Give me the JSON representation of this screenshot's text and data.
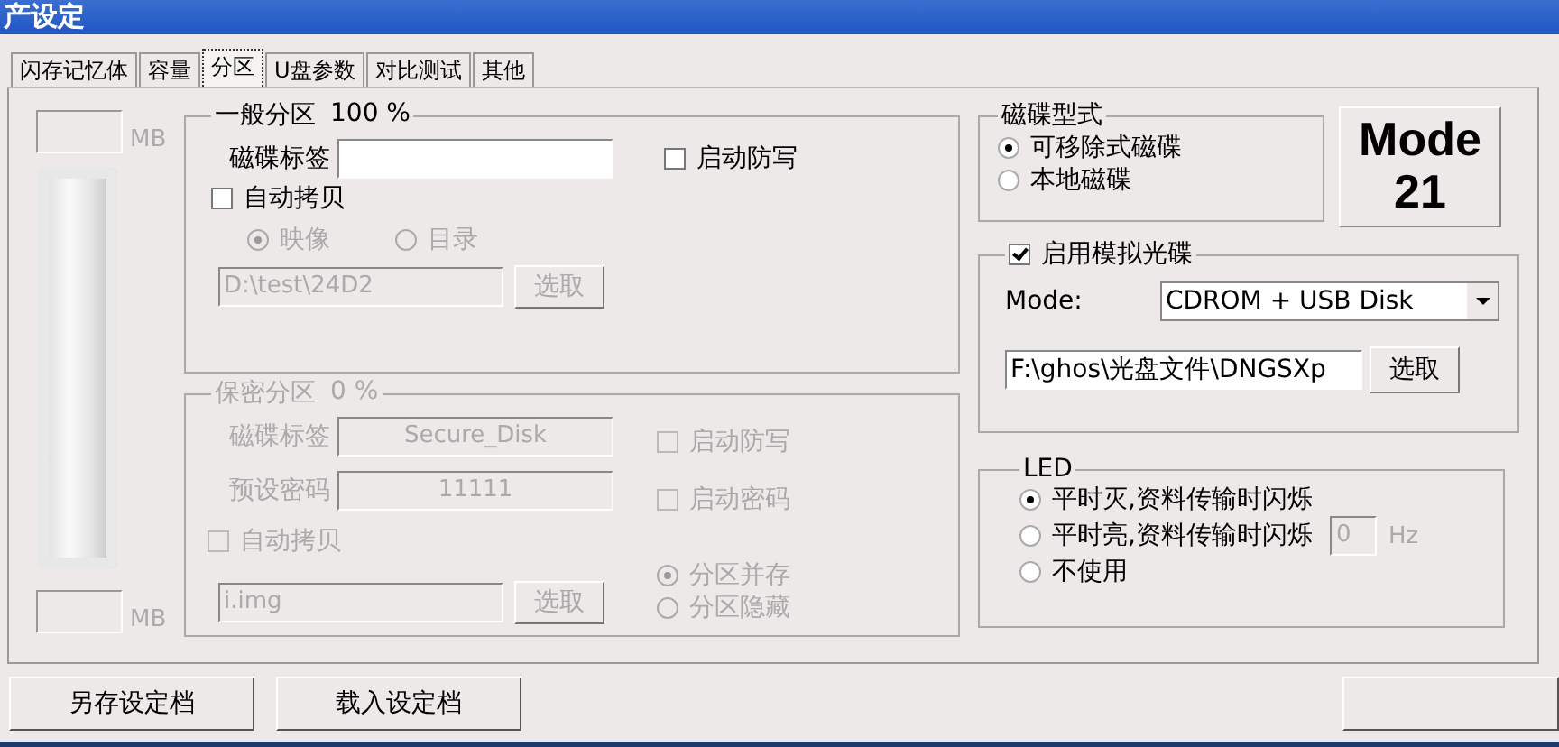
{
  "window": {
    "title": "产设定"
  },
  "tabs": [
    {
      "label": "闪存记忆体",
      "selected": false
    },
    {
      "label": "容量",
      "selected": false
    },
    {
      "label": "分区",
      "selected": true
    },
    {
      "label": "U盘参数",
      "selected": false
    },
    {
      "label": "对比测试",
      "selected": false
    },
    {
      "label": "其他",
      "selected": false
    }
  ],
  "capacity": {
    "top_unit": "MB",
    "bottom_unit": "MB"
  },
  "general_partition": {
    "title": "一般分区",
    "percent": "100 %",
    "disk_label": {
      "label": "磁碟标签"
    },
    "write_protect": {
      "label": "启动防写",
      "checked": false,
      "disabled": false
    },
    "auto_copy": {
      "label": "自动拷贝",
      "checked": false,
      "disabled": false
    },
    "copy_modes": [
      {
        "label": "映像",
        "selected": true,
        "disabled": true
      },
      {
        "label": "目录",
        "selected": false,
        "disabled": true
      }
    ],
    "path": {
      "value": "D:\\test\\24D2",
      "disabled": true
    },
    "select_button": {
      "label": "选取",
      "disabled": true
    }
  },
  "secure_partition": {
    "title": "保密分区",
    "percent": "0 %",
    "disabled": true,
    "disk_label": {
      "label": "磁碟标签",
      "value": "Secure_Disk"
    },
    "password": {
      "label": "预设密码",
      "value": "11111"
    },
    "write_protect": {
      "label": "启动防写",
      "checked": false
    },
    "enable_password": {
      "label": "启动密码",
      "checked": false
    },
    "auto_copy": {
      "label": "自动拷贝",
      "checked": false
    },
    "path": {
      "value": "i.img"
    },
    "select_button": {
      "label": "选取"
    },
    "partition_modes": [
      {
        "label": "分区并存",
        "selected": true
      },
      {
        "label": "分区隐藏",
        "selected": false
      }
    ]
  },
  "disk_type": {
    "title": "磁碟型式",
    "options": [
      {
        "label": "可移除式磁碟",
        "selected": true
      },
      {
        "label": "本地磁碟",
        "selected": false
      }
    ]
  },
  "mode_badge": {
    "lines": [
      "Mode",
      "21"
    ]
  },
  "virtual_cdrom": {
    "label": "启用模拟光碟",
    "checked": true,
    "mode_label": "Mode:",
    "mode_value": "CDROM + USB Disk",
    "path": "F:\\ghos\\光盘文件\\DNGSXp",
    "select_button": "选取"
  },
  "led": {
    "title": "LED",
    "options": [
      {
        "label": "平时灭,资料传输时闪烁",
        "selected": true
      },
      {
        "label": "平时亮,资料传输时闪烁",
        "selected": false
      },
      {
        "label": "不使用",
        "selected": false
      }
    ],
    "hz_value": "0",
    "hz_unit": "Hz",
    "hz_disabled": true
  },
  "buttons": [
    {
      "label": "另存设定档"
    },
    {
      "label": "载入设定档"
    }
  ]
}
